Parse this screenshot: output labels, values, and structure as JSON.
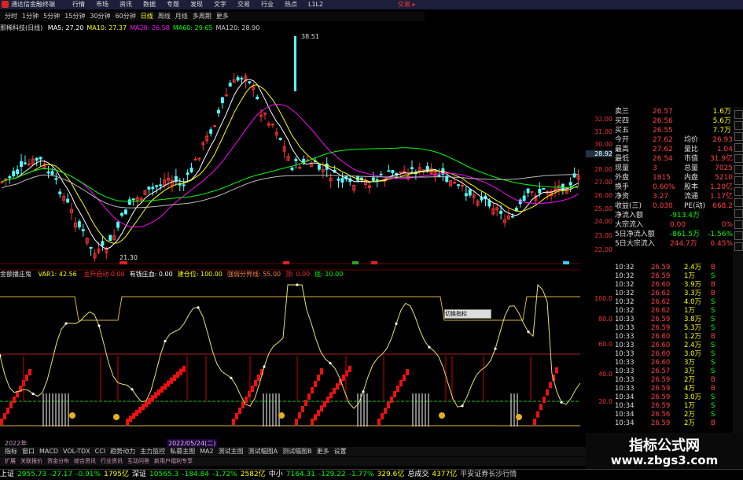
{
  "titlebar": {
    "title": "通达信金融终端",
    "nav": [
      "行情",
      "市场",
      "资讯",
      "数据",
      "专题",
      "发现",
      "文字",
      "交易",
      "行业",
      "热点",
      "L1L2"
    ],
    "right": "交易 ▸"
  },
  "periodbar": {
    "items": [
      "分时",
      "1分钟",
      "5分钟",
      "15分钟",
      "30分钟",
      "60分钟",
      "日线",
      "周线",
      "月线",
      "多周期",
      "更多"
    ],
    "active_index": 6
  },
  "mabar": {
    "stock": "那稀科技(日线)",
    "items": [
      {
        "label": "MA5: 27.20",
        "color": "#ffffff"
      },
      {
        "label": "MA10: 27.37",
        "color": "#ffff00"
      },
      {
        "label": "MA20: 26.58",
        "color": "#ff00ff"
      },
      {
        "label": "MA60: 29.65",
        "color": "#00ff00"
      },
      {
        "label": "MA120: 28.90",
        "color": "#cccccc"
      }
    ]
  },
  "main_chart": {
    "max_label": "38.51",
    "min_label": "21.30",
    "last_price_tag": "28.92",
    "axis": [
      "32.00",
      "31.00",
      "30.00",
      "29.00",
      "28.00",
      "27.00",
      "26.00",
      "25.00",
      "24.00",
      "23.00",
      "22.00"
    ]
  },
  "indicator": {
    "name": "金额播庄鬼",
    "var1": "VAR1: 42.56",
    "items": [
      {
        "label": "主升启动 0.00",
        "color": "#ff3030"
      },
      {
        "label": "有钱庄血: 0.00",
        "color": "#ffffff"
      },
      {
        "label": "建仓位: 100.00",
        "color": "#ffff00"
      },
      {
        "label": "强弱分界线: 55.00",
        "color": "#ff8040"
      },
      {
        "label": "顶: 0.00",
        "color": "#ff3030"
      },
      {
        "label": "底: 10.00",
        "color": "#00ff00"
      },
      {
        "label": "",
        "color": "#3030ff"
      }
    ],
    "axis": [
      "100.0",
      "80.0",
      "60.0",
      "40.0",
      "20.0"
    ],
    "popup": "切换指标"
  },
  "quote": {
    "rows": [
      {
        "k": "卖三",
        "v": "26.57",
        "v2": "1.6万"
      },
      {
        "k": "买四",
        "v": "26.56",
        "v2": "5.6万"
      },
      {
        "k": "买五",
        "v": "26.55",
        "v2": "7.7万"
      },
      {
        "k": "今开",
        "v": "27.62",
        "k2": "均价",
        "v3": "26.93"
      },
      {
        "k": "最高",
        "v": "27.62",
        "k2": "量比",
        "v3": "1.04"
      },
      {
        "k": "最低",
        "v": "26.54",
        "k2": "市值",
        "v3": "31.9亿"
      },
      {
        "k": "现量",
        "v": "3",
        "k2": "总量",
        "v3": "7025"
      },
      {
        "k": "外盘",
        "v": "1815",
        "k2": "内盘",
        "v3": "5210"
      },
      {
        "k": "换手",
        "v": "0.60%",
        "k2": "股本",
        "v3": "1.20亿"
      },
      {
        "k": "净资",
        "v": "3.27",
        "k2": "流通",
        "v3": "1.17亿"
      },
      {
        "k": "收益(三)",
        "v": "0.030",
        "k2": "PE(动)",
        "v3": "668.2"
      }
    ],
    "flows": [
      {
        "k": "净流入额",
        "v": "-913.4万"
      },
      {
        "k": "大宗流入",
        "v": "0.00",
        "v2": "0%"
      },
      {
        "k": "5日净流入额",
        "v": "-861.5万",
        "v2": "-1.56%"
      },
      {
        "k": "5日大宗流入",
        "v": "244.7万",
        "v2": "0.45%"
      }
    ]
  },
  "ticks": [
    [
      "10:32",
      "26.59",
      "2.4万",
      "B"
    ],
    [
      "10:32",
      "26.59",
      "1万",
      "S"
    ],
    [
      "10:32",
      "26.60",
      "3.9万",
      "B"
    ],
    [
      "10:32",
      "26.62",
      "3.3万",
      "B"
    ],
    [
      "10:32",
      "26.62",
      "4.0万",
      "S"
    ],
    [
      "10:32",
      "26.62",
      "1万",
      "S"
    ],
    [
      "10:33",
      "26.59",
      "3.8万",
      "S"
    ],
    [
      "10:33",
      "26.59",
      "5.3万",
      "S"
    ],
    [
      "10:33",
      "26.60",
      "1.2万",
      "B"
    ],
    [
      "10:33",
      "26.60",
      "2.4万",
      "S"
    ],
    [
      "10:33",
      "26.60",
      "3.0万",
      "S"
    ],
    [
      "10:33",
      "26.60",
      "3万",
      "S"
    ],
    [
      "10:33",
      "26.57",
      "3万",
      "S"
    ],
    [
      "10:33",
      "26.59",
      "2万",
      "B"
    ],
    [
      "10:33",
      "26.59",
      "4万",
      "B"
    ],
    [
      "10:34",
      "26.59",
      "3.0万",
      "S"
    ],
    [
      "10:34",
      "26.59",
      "1万",
      "S"
    ],
    [
      "10:34",
      "26.56",
      "2万",
      "S"
    ],
    [
      "10:34",
      "26.59",
      "2万",
      "B"
    ]
  ],
  "dates": {
    "start": "2022年",
    "cursor": "2022/05/24(二)"
  },
  "tabs": [
    "指标",
    "窗口",
    "MACD",
    "VOL-TDX",
    "CCI",
    "趋势动力",
    "主力监控",
    "私募主图",
    "MA2",
    "测试主图",
    "测试幅图A",
    "测试幅图B",
    "更多",
    "设置"
  ],
  "tabs2": [
    "扩展",
    "关联报价",
    "资金分布",
    "综合资讯",
    "行业资讯",
    "互动问答",
    "新用户福利专享"
  ],
  "status": [
    {
      "t": "上证",
      "c": "#ffffff"
    },
    {
      "t": "2955.73",
      "c": "#00ff00"
    },
    {
      "t": "-27.17",
      "c": "#00ff00"
    },
    {
      "t": "-0.91%",
      "c": "#00ff00"
    },
    {
      "t": "1795亿",
      "c": "#ffff00"
    },
    {
      "t": "深证",
      "c": "#ffffff"
    },
    {
      "t": "10565.3",
      "c": "#00ff00"
    },
    {
      "t": "-184.84",
      "c": "#00ff00"
    },
    {
      "t": "-1.72%",
      "c": "#00ff00"
    },
    {
      "t": "2582亿",
      "c": "#ffff00"
    },
    {
      "t": "中小",
      "c": "#ffffff"
    },
    {
      "t": "7164.31",
      "c": "#00ff00"
    },
    {
      "t": "-129.22",
      "c": "#00ff00"
    },
    {
      "t": "-1.77%",
      "c": "#00ff00"
    },
    {
      "t": "329.6亿",
      "c": "#ffff00"
    },
    {
      "t": "总成交",
      "c": "#ffffff"
    },
    {
      "t": "4377亿",
      "c": "#ffff00"
    },
    {
      "t": "平安证券长沙行情",
      "c": "#cccccc"
    }
  ],
  "watermark": {
    "line1": "指标公式网",
    "line2": "www.zbgs3.com"
  },
  "colors": {
    "up": "#ff3333",
    "down": "#54ffff",
    "ma5": "#ffffff",
    "ma10": "#ffff00",
    "ma20": "#ff00ff",
    "ma60": "#00ff00",
    "ma120": "#cccccc"
  }
}
